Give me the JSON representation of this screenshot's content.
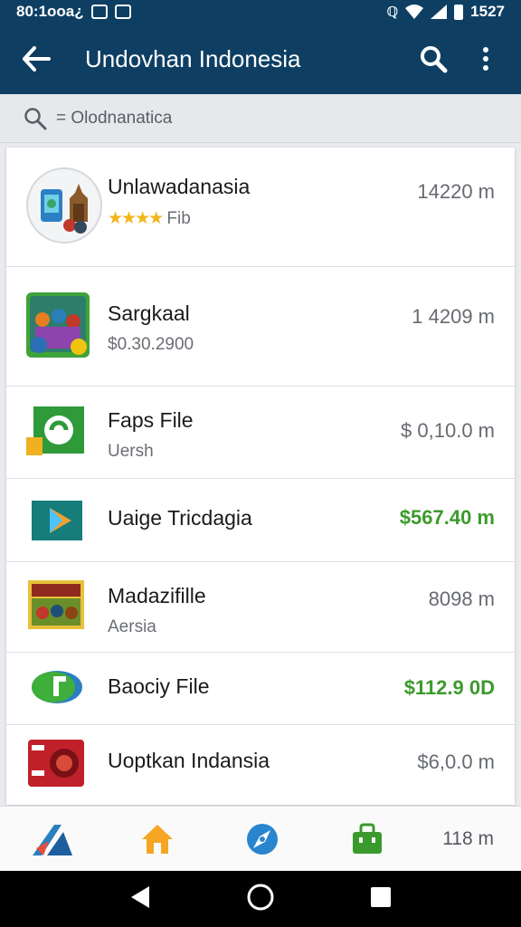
{
  "status_bar": {
    "time_text": "80:1ooa¿",
    "clock": "1527"
  },
  "app_bar": {
    "title": "Undovhan Indonesia"
  },
  "search": {
    "text": "= Olodnanatica"
  },
  "items": [
    {
      "name": "Unlawadanasia",
      "sub": "Fib",
      "rating_stars": 4,
      "price": "14220 m",
      "price_style": "gray"
    },
    {
      "name": "Sargkaal",
      "sub": "$0.30.2900",
      "price": "1 4209 m",
      "price_style": "gray"
    },
    {
      "name": "Faps File",
      "sub": "Uersh",
      "price": "$ 0,10.0 m",
      "price_style": "gray"
    },
    {
      "name": "Uaige Tricdagia",
      "sub": "",
      "price": "$567.40 m",
      "price_style": "green"
    },
    {
      "name": "Madazifille",
      "sub": "Aersia",
      "price": "8098 m",
      "price_style": "gray"
    },
    {
      "name": "Baociy File",
      "sub": "",
      "price": "$112.9 0D",
      "price_style": "green"
    },
    {
      "name": "Uoptkan Indansia",
      "sub": "",
      "price": "$6,0.0 m",
      "price_style": "gray"
    }
  ],
  "bottom_nav": {
    "price": "118 m"
  },
  "icons": {
    "back": "arrow-left-icon",
    "search": "search-icon",
    "more": "more-vert-icon",
    "home": "home-icon",
    "compass": "compass-icon",
    "bag": "shopping-bag-icon"
  },
  "colors": {
    "app_bar": "#0e3f63",
    "price_green": "#3c9a2c",
    "star": "#f3b51b"
  }
}
